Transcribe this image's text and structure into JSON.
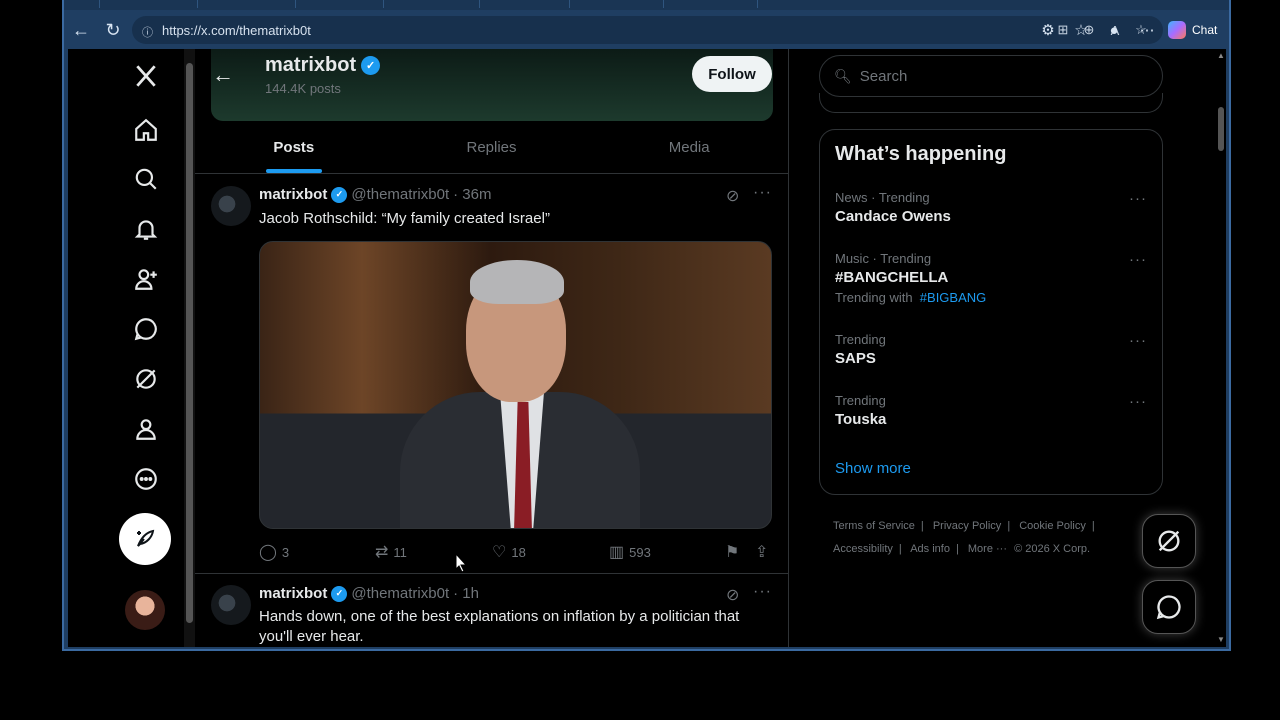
{
  "browser": {
    "url": "https://x.com/thematrixb0t",
    "chat_label": "Chat"
  },
  "profile": {
    "name": "matrixbot",
    "posts_count": "144.4K posts",
    "follow_label": "Follow"
  },
  "tabs": [
    {
      "label": "Posts",
      "active": true
    },
    {
      "label": "Replies",
      "active": false
    },
    {
      "label": "Media",
      "active": false
    }
  ],
  "tweets": [
    {
      "name": "matrixbot",
      "handle": "@thematrixb0t",
      "time": "· 36m",
      "text": "Jacob Rothschild: “My family created Israel”",
      "replies": "3",
      "reposts": "11",
      "likes": "18",
      "views": "593"
    },
    {
      "name": "matrixbot",
      "handle": "@thematrixb0t",
      "time": "· 1h",
      "text": "Hands down, one of the best explanations on inflation by a politician that you'll ever hear."
    }
  ],
  "search": {
    "placeholder": "Search"
  },
  "happening": {
    "title": "What’s happening",
    "trends": [
      {
        "context": "News · Trending",
        "name": "Candace Owens",
        "with_label": "",
        "with_tag": ""
      },
      {
        "context": "Music · Trending",
        "name": "#BANGCHELLA",
        "with_label": "Trending with",
        "with_tag": "#BIGBANG"
      },
      {
        "context": "Trending",
        "name": "SAPS",
        "with_label": "",
        "with_tag": ""
      },
      {
        "context": "Trending",
        "name": "Touska",
        "with_label": "",
        "with_tag": ""
      }
    ],
    "show_more": "Show more"
  },
  "footer": {
    "terms": "Terms of Service",
    "privacy": "Privacy Policy",
    "cookie": "Cookie Policy",
    "accessibility": "Accessibility",
    "ads": "Ads info",
    "more": "More ···",
    "copyright": "© 2026 X Corp."
  },
  "colors": {
    "accent": "#1d9bf0",
    "background": "#000000",
    "browser_frame": "#1f3e62"
  }
}
